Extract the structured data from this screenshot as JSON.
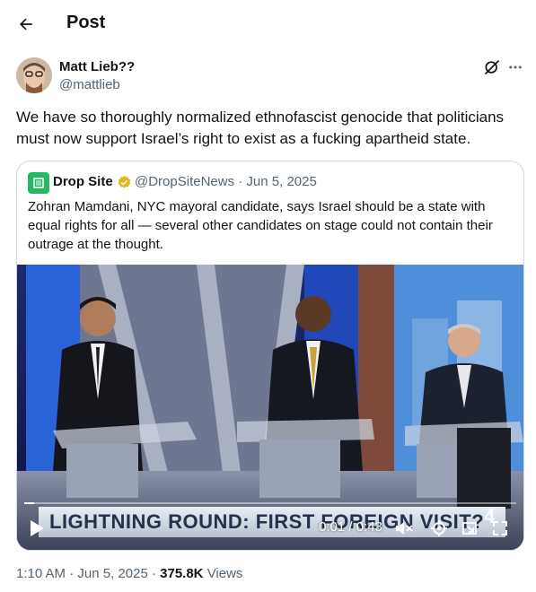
{
  "header": {
    "title": "Post"
  },
  "post": {
    "author_name": "Matt Lieb??",
    "author_handle": "@mattlieb",
    "text": "We have so thoroughly normalized ethnofascist genocide that politicians must now support Israel’s right to exist as a fucking apartheid state.",
    "time": "1:10 AM",
    "date": "Jun 5, 2025",
    "views_count": "375.8K",
    "views_label": "Views"
  },
  "quote": {
    "name": "Drop Site",
    "handle_date": "@DropSiteNews · Jun 5, 2025",
    "text": "Zohran Mamdani, NYC mayoral candidate, says Israel should be a state with equal rights for all — several other candidates on stage could not contain their outrage at the thought.",
    "video": {
      "lower_third": "LIGHTNING ROUND: FIRST FOREIGN VISIT?",
      "time": "0:01 / 0:43",
      "progress": 0.02,
      "channel_mark": "4"
    }
  },
  "colors": {
    "text_primary": "#0f1419",
    "text_secondary": "#536471",
    "border": "#cfd9de",
    "verified": "#e2b719",
    "dropsite_green": "#27b764"
  },
  "icons": {
    "back": "arrow-left-icon",
    "grok": "grok-icon",
    "more": "more-horizontal-icon",
    "verified": "verified-badge-icon",
    "play": "play-icon",
    "volume": "volume-muted-icon",
    "settings": "gear-icon",
    "pip": "picture-in-picture-icon",
    "fullscreen": "fullscreen-icon"
  }
}
